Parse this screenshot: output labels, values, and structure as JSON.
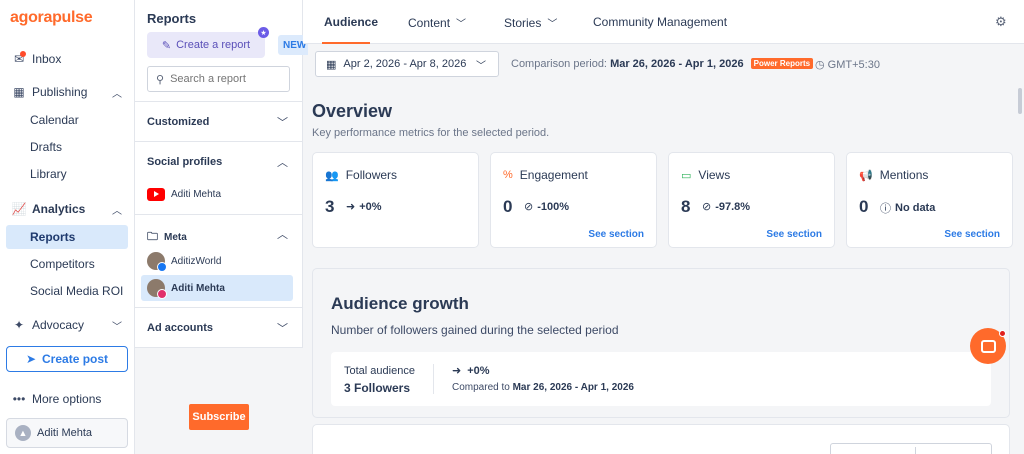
{
  "app": {
    "logo": "agorapulse"
  },
  "nav": {
    "inbox": "Inbox",
    "publishing": "Publishing",
    "calendar": "Calendar",
    "drafts": "Drafts",
    "library": "Library",
    "analytics": "Analytics",
    "reports": "Reports",
    "competitors": "Competitors",
    "social_roi": "Social Media ROI",
    "advocacy": "Advocacy",
    "create_post": "Create post",
    "more_options": "More options",
    "user_name": "Aditi Mehta"
  },
  "reports_panel": {
    "title": "Reports",
    "create_report": "Create a report",
    "new_badge": "NEW",
    "search_placeholder": "Search a report",
    "customized": "Customized",
    "social_profiles": "Social profiles",
    "profiles": [
      "Aditi Mehta",
      "AditizWorld",
      "Aditi Mehta"
    ],
    "meta_group": "Meta",
    "ad_accounts": "Ad accounts",
    "subscribe": "Subscribe"
  },
  "tabs": [
    "Audience",
    "Content",
    "Stories",
    "Community Management"
  ],
  "filters": {
    "date_range": "Apr 2, 2026 - Apr 8, 2026",
    "comparison_label": "Comparison period:",
    "comparison_range": "Mar 26, 2026 - Apr 1, 2026",
    "power_badge": "Power Reports",
    "timezone": "GMT+5:30"
  },
  "overview": {
    "title": "Overview",
    "subtitle": "Key performance metrics for the selected period.",
    "cards": [
      {
        "title": "Followers",
        "value": "3",
        "delta": "+0%",
        "link": ""
      },
      {
        "title": "Engagement",
        "value": "0",
        "delta": "-100%",
        "link": "See section"
      },
      {
        "title": "Views",
        "value": "8",
        "delta": "-97.8%",
        "link": "See section"
      },
      {
        "title": "Mentions",
        "value": "0",
        "delta": "No data",
        "link": "See section"
      }
    ]
  },
  "growth": {
    "title": "Audience growth",
    "subtitle": "Number of followers gained during the selected period",
    "total_label": "Total audience",
    "total_value": "3 Followers",
    "delta": "+0%",
    "compared_label": "Compared to",
    "compared_range": "Mar 26, 2026 - Apr 1, 2026"
  },
  "colors": {
    "accent": "#ff6a2b",
    "link": "#2d7be5",
    "active_bg": "#d9e9fb"
  }
}
